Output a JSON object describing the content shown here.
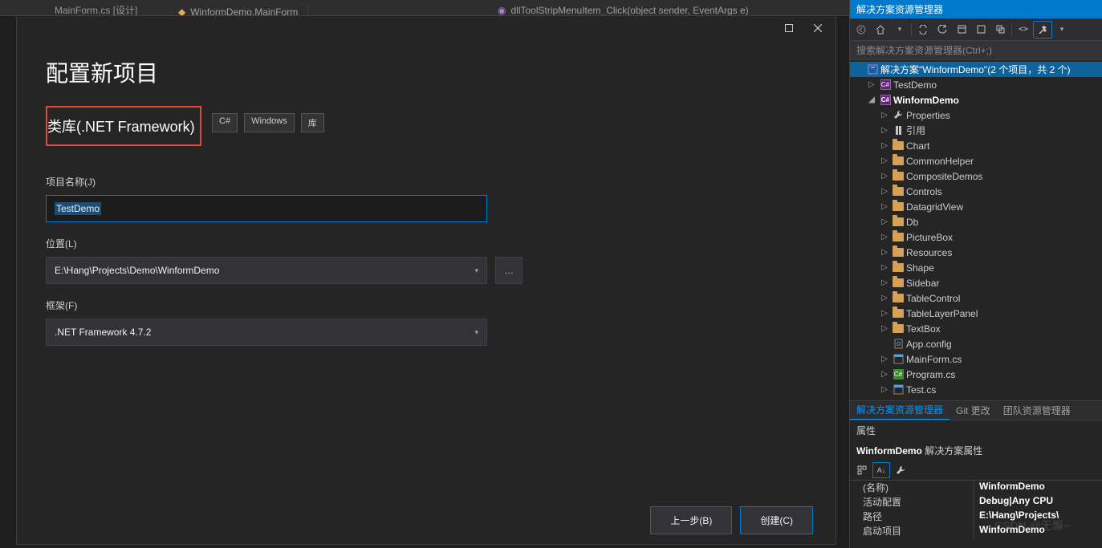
{
  "topTab": "MainForm.cs [设计]",
  "editorTabs": [
    {
      "icon": "form",
      "label": "WinformDemo.MainForm"
    },
    {
      "icon": "method",
      "label": "dllToolStripMenuItem_Click(object sender, EventArgs e)"
    }
  ],
  "dialog": {
    "title": "配置新项目",
    "templateName": "类库(.NET Framework)",
    "tags": [
      "C#",
      "Windows",
      "库"
    ],
    "fields": {
      "projectNameLabel": "项目名称(J)",
      "projectName": "TestDemo",
      "locationLabel": "位置(L)",
      "location": "E:\\Hang\\Projects\\Demo\\WinformDemo",
      "frameworkLabel": "框架(F)",
      "framework": ".NET Framework 4.7.2"
    },
    "buttons": {
      "back": "上一步(B)",
      "create": "创建(C)"
    }
  },
  "solutionExplorer": {
    "panelTitle": "解决方案资源管理器",
    "searchPlaceholder": "搜索解决方案资源管理器(Ctrl+;)",
    "solutionLabel": "解决方案\"WinformDemo\"(2 个项目，共 2 个)",
    "projects": [
      {
        "name": "TestDemo",
        "expanded": false,
        "bold": false
      },
      {
        "name": "WinformDemo",
        "expanded": true,
        "bold": true
      }
    ],
    "winformChildren": [
      {
        "type": "props",
        "name": "Properties"
      },
      {
        "type": "ref",
        "name": "引用"
      },
      {
        "type": "folder",
        "name": "Chart"
      },
      {
        "type": "folder",
        "name": "CommonHelper"
      },
      {
        "type": "folder",
        "name": "CompositeDemos"
      },
      {
        "type": "folder",
        "name": "Controls"
      },
      {
        "type": "folder",
        "name": "DatagridView"
      },
      {
        "type": "folder",
        "name": "Db"
      },
      {
        "type": "folder",
        "name": "PictureBox"
      },
      {
        "type": "folder",
        "name": "Resources"
      },
      {
        "type": "folder",
        "name": "Shape"
      },
      {
        "type": "folder",
        "name": "Sidebar"
      },
      {
        "type": "folder",
        "name": "TableControl"
      },
      {
        "type": "folder",
        "name": "TableLayerPanel"
      },
      {
        "type": "folder",
        "name": "TextBox"
      },
      {
        "type": "config",
        "name": "App.config"
      },
      {
        "type": "form",
        "name": "MainForm.cs"
      },
      {
        "type": "cs",
        "name": "Program.cs"
      },
      {
        "type": "form",
        "name": "Test.cs"
      }
    ],
    "bottomTabs": [
      "解决方案资源管理器",
      "Git 更改",
      "团队资源管理器"
    ]
  },
  "properties": {
    "header": "属性",
    "object": "WinformDemo",
    "objectType": "解决方案属性",
    "rows": [
      {
        "k": "(名称)",
        "v": "WinformDemo"
      },
      {
        "k": "活动配置",
        "v": "Debug|Any CPU"
      },
      {
        "k": "路径",
        "v": "E:\\Hang\\Projects\\"
      },
      {
        "k": "启动项目",
        "v": "WinformDemo"
      }
    ]
  },
  "watermark": "CSDN @无懈~"
}
